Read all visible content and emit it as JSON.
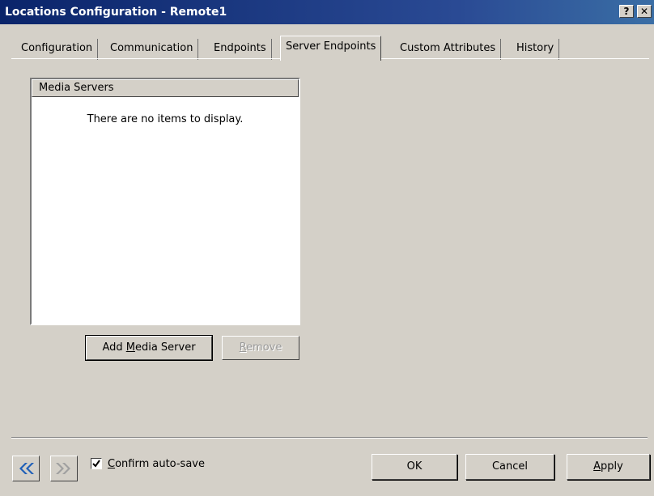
{
  "window": {
    "title": "Locations Configuration - Remote1",
    "help_glyph": "?",
    "close_glyph": "✕"
  },
  "tabs": [
    {
      "label": "Configuration",
      "active": false
    },
    {
      "label": "Communication",
      "active": false
    },
    {
      "label": "Endpoints",
      "active": false
    },
    {
      "label": "Server Endpoints",
      "active": true
    },
    {
      "label": "Custom Attributes",
      "active": false
    },
    {
      "label": "History",
      "active": false
    }
  ],
  "media_servers": {
    "header": "Media Servers",
    "empty_text": "There are no items to display.",
    "items": []
  },
  "buttons": {
    "add_media_server": {
      "pre": "Add ",
      "mnemonic": "M",
      "post": "edia Server"
    },
    "remove": {
      "pre": "",
      "mnemonic": "R",
      "post": "emove",
      "disabled": true
    },
    "ok": "OK",
    "cancel": "Cancel",
    "apply": {
      "pre": "",
      "mnemonic": "A",
      "post": "pply"
    }
  },
  "footer": {
    "back_icon": "double-chevron-left-icon",
    "forward_icon": "double-chevron-right-icon",
    "confirm_autosave": {
      "pre": "",
      "mnemonic": "C",
      "post": "onfirm auto-save",
      "checked": true
    }
  },
  "colors": {
    "titlebar": "#0a246a",
    "face": "#d4d0c8",
    "nav_arrow_active": "#1f5fb8",
    "nav_arrow_disabled": "#a0a0a0"
  }
}
